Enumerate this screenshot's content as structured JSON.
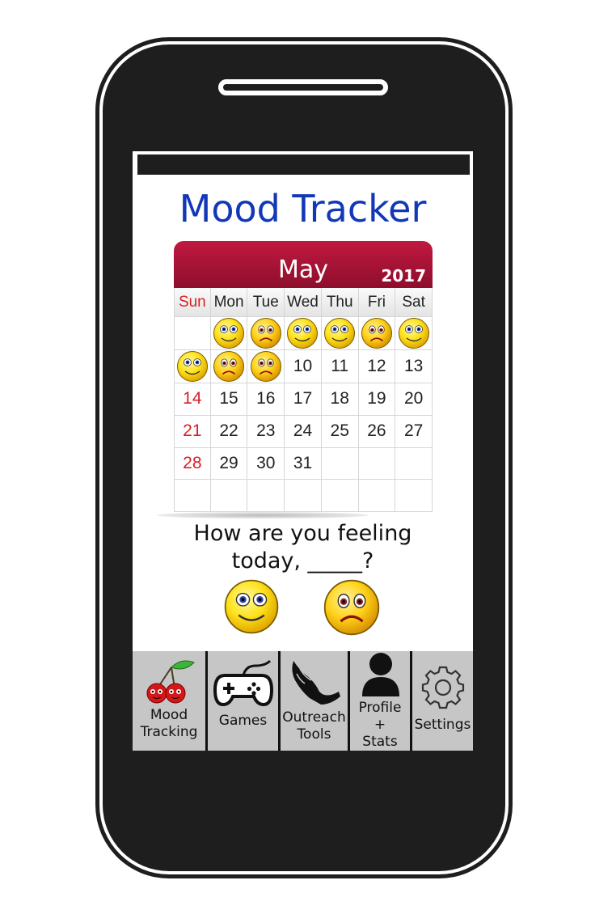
{
  "app": {
    "title": "Mood Tracker"
  },
  "calendar": {
    "month": "May",
    "year": "2017",
    "weekdays": [
      "Sun",
      "Mon",
      "Tue",
      "Wed",
      "Thu",
      "Fri",
      "Sat"
    ],
    "cells": [
      "",
      "happy",
      "sad",
      "happy",
      "happy",
      "sad",
      "happy",
      "happy",
      "sad",
      "sad",
      "10",
      "11",
      "12",
      "13",
      "14",
      "15",
      "16",
      "17",
      "18",
      "19",
      "20",
      "21",
      "22",
      "23",
      "24",
      "25",
      "26",
      "27",
      "28",
      "29",
      "30",
      "31",
      "",
      "",
      "",
      "",
      "",
      "",
      "",
      "",
      "",
      ""
    ]
  },
  "prompt": {
    "line1": "How are you feeling",
    "line2": "today, _____?"
  },
  "mood_options": [
    "happy",
    "sad"
  ],
  "nav": [
    {
      "label": "Mood\nTracking",
      "icon": "cherry-icon"
    },
    {
      "label": "Games",
      "icon": "gamepad-icon"
    },
    {
      "label": "Outreach\nTools",
      "icon": "hand-icon"
    },
    {
      "label": "Profile\n+\nStats",
      "icon": "person-icon"
    },
    {
      "label": "Settings",
      "icon": "gear-icon"
    }
  ],
  "colors": {
    "title": "#1238b8",
    "calendar_header": "#a3102f",
    "sunday": "#d81f26",
    "nav_bg": "#c6c6c6",
    "phone": "#1e1e1e"
  }
}
